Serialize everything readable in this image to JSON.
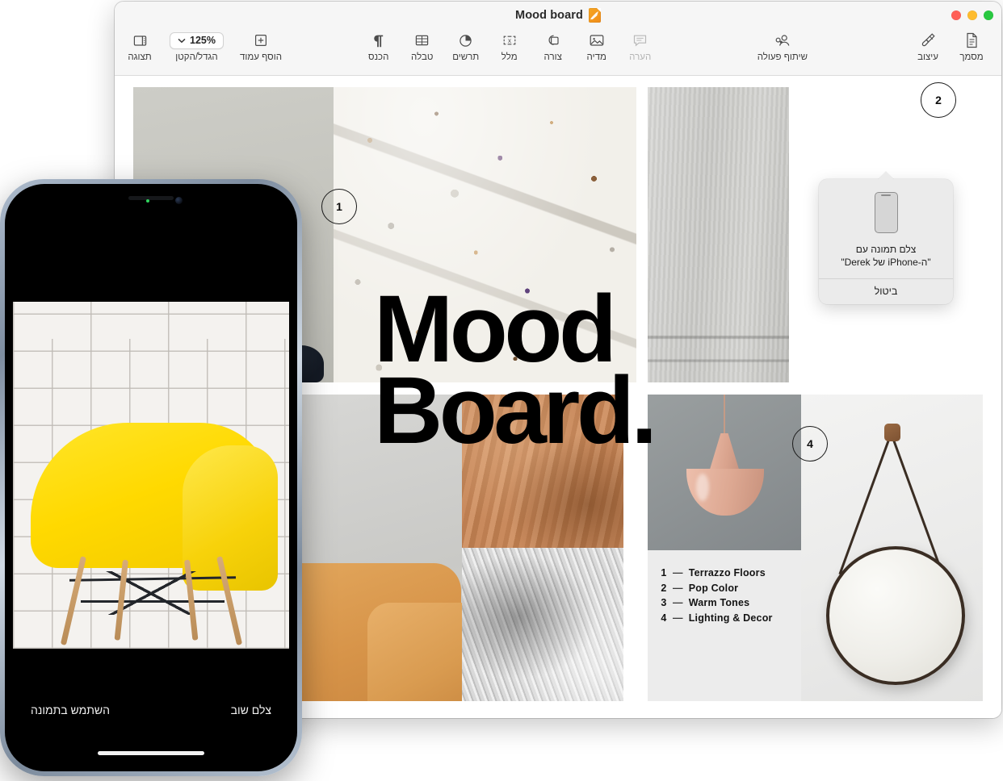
{
  "window": {
    "title": "Mood board",
    "doc_icon": "pages-document-icon",
    "traffic_lights": [
      {
        "name": "maximize-button",
        "color": "#28c840"
      },
      {
        "name": "minimize-button",
        "color": "#febc2e"
      },
      {
        "name": "close-button",
        "color": "#ff5f57"
      }
    ]
  },
  "toolbar": {
    "groups": {
      "left": [
        {
          "id": "document",
          "label": "מסמך",
          "icon": "document-icon",
          "dim": false
        },
        {
          "id": "format",
          "label": "עיצוב",
          "icon": "paintbrush-icon",
          "dim": false
        }
      ],
      "share": [
        {
          "id": "collaborate",
          "label": "שיתוף פעולה",
          "icon": "collaborate-person-icon",
          "dim": false
        }
      ],
      "insert": [
        {
          "id": "comment",
          "label": "הערה",
          "icon": "comment-bubble-icon",
          "dim": true
        },
        {
          "id": "media",
          "label": "מדיה",
          "icon": "media-image-icon",
          "dim": false
        },
        {
          "id": "shape",
          "label": "צורה",
          "icon": "shapes-icon",
          "dim": false
        },
        {
          "id": "textbox",
          "label": "מלל",
          "icon": "text-box-icon",
          "dim": false
        },
        {
          "id": "chart",
          "label": "תרשים",
          "icon": "pie-chart-icon",
          "dim": false
        },
        {
          "id": "table",
          "label": "טבלה",
          "icon": "table-grid-icon",
          "dim": false
        },
        {
          "id": "insert",
          "label": "הכנס",
          "icon": "pilcrow-icon",
          "dim": false
        }
      ],
      "right": [
        {
          "id": "addpage",
          "label": "הוסף עמוד",
          "icon": "plus-square-icon",
          "dim": false
        },
        {
          "id": "zoom",
          "label": "הגדל/הקטן",
          "icon": "chevron-down-icon",
          "value": "125%",
          "dim": false
        },
        {
          "id": "view",
          "label": "תצוגה",
          "icon": "sidebar-view-icon",
          "dim": false
        }
      ]
    }
  },
  "document": {
    "headline_line1": "Mood",
    "headline_line2": "Board.",
    "badges": [
      {
        "id": "badge-1",
        "number": "1"
      },
      {
        "id": "badge-2",
        "number": "2"
      },
      {
        "id": "badge-4",
        "number": "4"
      }
    ],
    "legend": [
      {
        "num": "1",
        "dash": "—",
        "label": "Terrazzo Floors"
      },
      {
        "num": "2",
        "dash": "—",
        "label": "Pop Color"
      },
      {
        "num": "3",
        "dash": "—",
        "label": "Warm Tones"
      },
      {
        "num": "4",
        "dash": "—",
        "label": "Lighting & Decor"
      }
    ],
    "images": [
      {
        "id": "wall",
        "alt": "gray-wall-swatch"
      },
      {
        "id": "terrazzo",
        "alt": "terrazzo-stone-texture"
      },
      {
        "id": "concrete",
        "alt": "concrete-wall-texture"
      },
      {
        "id": "plaster-sofa",
        "alt": "tan-leather-sofa-on-plaster-wall"
      },
      {
        "id": "wood",
        "alt": "wood-grain-texture"
      },
      {
        "id": "rug",
        "alt": "gray-shag-rug-texture"
      },
      {
        "id": "lamp",
        "alt": "pink-pendant-lamp"
      },
      {
        "id": "mirror",
        "alt": "round-hanging-mirror"
      }
    ]
  },
  "popover": {
    "icon": "iphone-device-icon",
    "message": "צלם תמונה עם\nה-iPhone של Derek\"\"",
    "message_line1": "צלם תמונה עם",
    "message_line2": "\"ה-iPhone של Derek\"",
    "cancel_label": "ביטול"
  },
  "iphone": {
    "photo_alt": "yellow-eames-chair-against-white-brick-wall",
    "retake_label": "צלם שוב",
    "use_photo_label": "השתמש בתמונה"
  }
}
